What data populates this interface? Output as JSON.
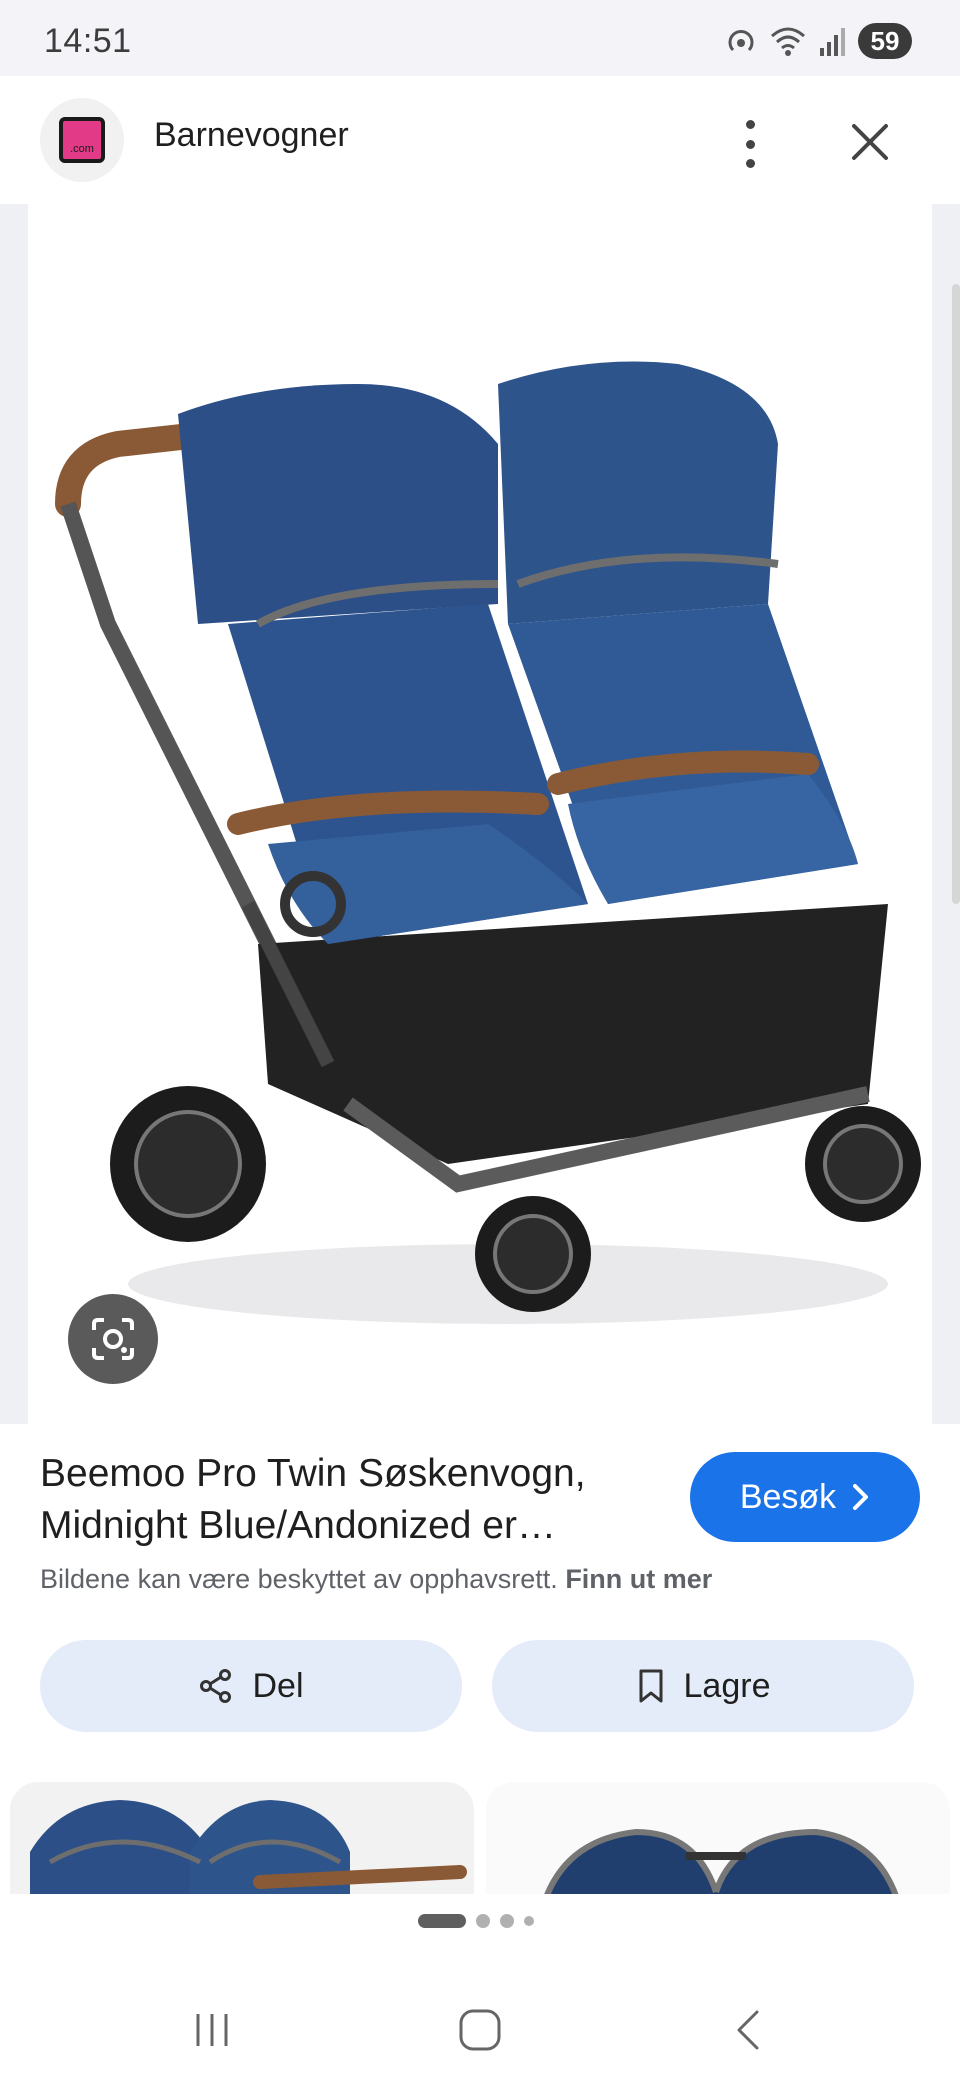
{
  "status_bar": {
    "time": "14:51",
    "battery": "59",
    "icons": [
      "hotspot-icon",
      "wifi-icon",
      "signal-icon",
      "battery-icon"
    ]
  },
  "header": {
    "title": "Barnevogner",
    "logo_text": ".com",
    "icons": [
      "more-vert-icon",
      "close-icon"
    ]
  },
  "product": {
    "title": "Beemoo Pro Twin Søskenvogn, Midnight Blue/Andonized er…",
    "visit_label": "Besøk",
    "copyright_text": "Bildene kan være beskyttet av opphavsrett.",
    "learn_more": "Finn ut mer"
  },
  "actions": {
    "share_label": "Del",
    "save_label": "Lagre"
  },
  "colors": {
    "accent": "#1a73e8",
    "pill_bg": "#e4ecf9",
    "stroller_blue": "#2b4f86"
  },
  "pager": {
    "total": 4,
    "active_index": 0
  }
}
